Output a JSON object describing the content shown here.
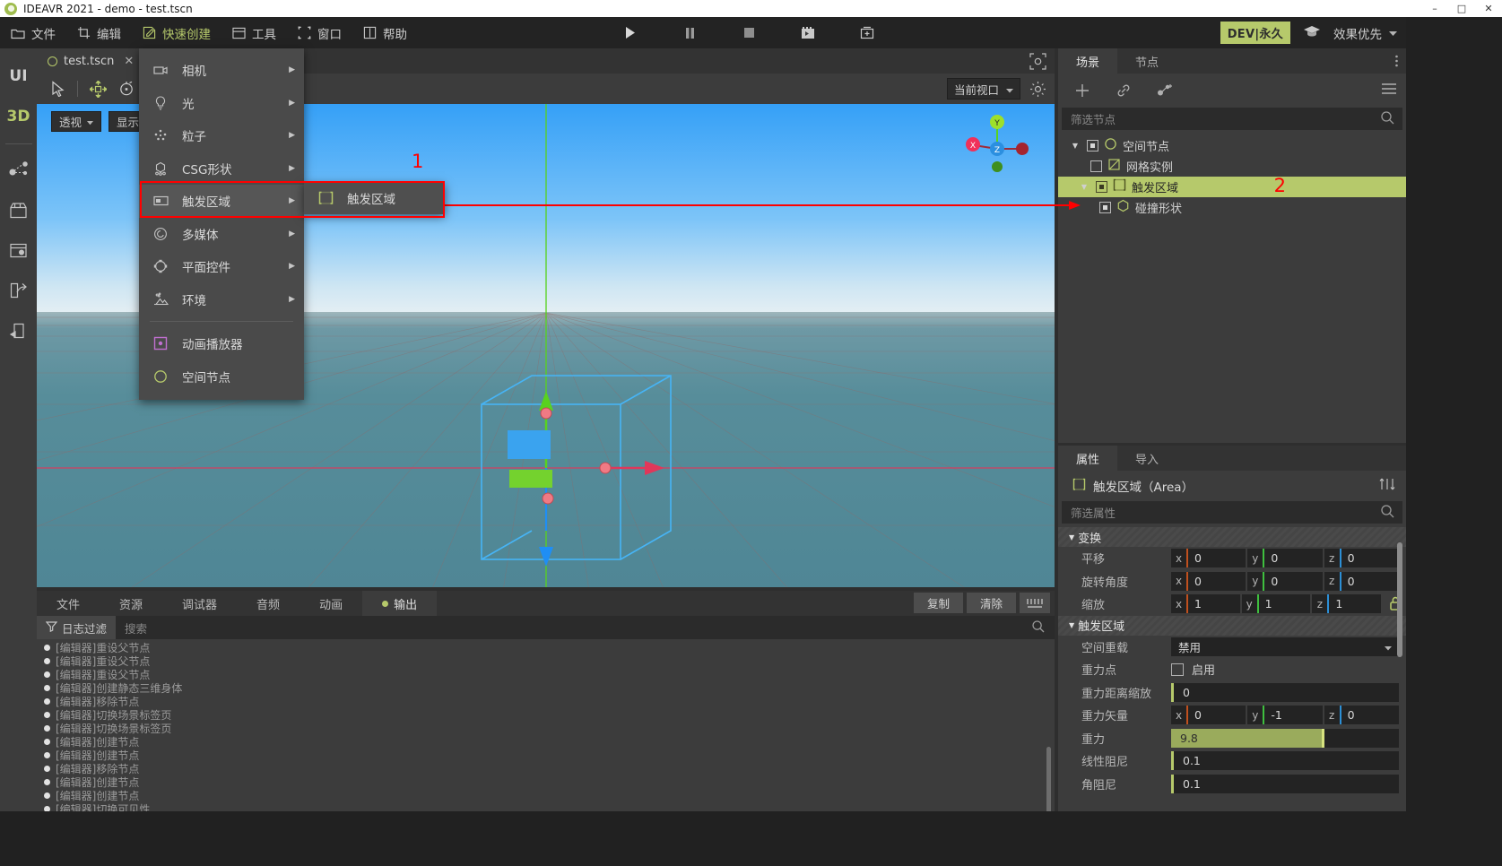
{
  "titlebar": {
    "title": "IDEAVR 2021 - demo - test.tscn",
    "minimize": "–",
    "maximize": "□",
    "close": "✕"
  },
  "menubar": {
    "items": [
      {
        "label": "文件",
        "icon": "folder-icon",
        "active": false
      },
      {
        "label": "编辑",
        "icon": "crop-icon",
        "active": false
      },
      {
        "label": "快速创建",
        "icon": "pencil-square-icon",
        "active": true
      },
      {
        "label": "工具",
        "icon": "window-icon",
        "active": false
      },
      {
        "label": "窗口",
        "icon": "frame-icon",
        "active": false
      },
      {
        "label": "帮助",
        "icon": "book-icon",
        "active": false
      }
    ],
    "play_controls": [
      "play-icon",
      "pause-icon",
      "stop-icon",
      "movie-icon",
      "movie-add-icon"
    ],
    "dev_badge": "DEV|永久",
    "graduation_icon": "graduation-cap-icon",
    "quality_label": "效果优先",
    "accent": "#b6c96b"
  },
  "left_rail": {
    "items": [
      {
        "label": "UI",
        "name": "rail-item-ui",
        "selected": false
      },
      {
        "label": "3D",
        "name": "rail-item-3d",
        "selected": true
      },
      {
        "label": "",
        "name": "rail-item-graph",
        "icon": "node-graph-icon",
        "selected": false
      },
      {
        "label": "",
        "name": "rail-item-store",
        "icon": "store-icon",
        "selected": false
      },
      {
        "label": "",
        "name": "rail-item-settings",
        "icon": "window-settings-icon",
        "selected": false
      },
      {
        "label": "",
        "name": "rail-item-export",
        "icon": "share-export-icon",
        "selected": false
      },
      {
        "label": "",
        "name": "rail-item-publish",
        "icon": "publish-icon",
        "selected": false
      }
    ]
  },
  "viewport": {
    "tab": {
      "label": "test.tscn",
      "close": "✕"
    },
    "focus_icon": "focus-frame-icon",
    "tools": [
      "select-arrow-icon",
      "move-icon",
      "rotate-icon",
      "scale-icon"
    ],
    "overlays": [
      {
        "label": "透视",
        "name": "perspective-dropdown"
      },
      {
        "label": "显示",
        "name": "display-dropdown"
      }
    ],
    "view_select": "当前视口",
    "gear_icon": "gear-icon",
    "gizmo_axes": [
      "X",
      "Y",
      "Z"
    ]
  },
  "quick_create_menu": {
    "items": [
      {
        "label": "相机",
        "icon": "camera-icon",
        "submenu": true,
        "highlight": false
      },
      {
        "label": "光",
        "icon": "bulb-icon",
        "submenu": true,
        "highlight": false
      },
      {
        "label": "粒子",
        "icon": "particles-icon",
        "submenu": true,
        "highlight": false
      },
      {
        "label": "CSG形状",
        "icon": "csg-icon",
        "submenu": true,
        "highlight": false
      },
      {
        "label": "触发区域",
        "icon": "trigger-area-icon",
        "submenu": true,
        "highlight": true
      },
      {
        "label": "多媒体",
        "icon": "media-icon",
        "submenu": true,
        "highlight": false
      },
      {
        "label": "平面控件",
        "icon": "plane-control-icon",
        "submenu": true,
        "highlight": false
      },
      {
        "label": "环境",
        "icon": "environment-icon",
        "submenu": true,
        "highlight": false
      }
    ],
    "extra_items": [
      {
        "label": "动画播放器",
        "icon": "anim-player-icon",
        "submenu": false
      },
      {
        "label": "空间节点",
        "icon": "spatial-node-icon",
        "submenu": false
      }
    ],
    "submenu": {
      "items": [
        {
          "label": "触发区域",
          "icon": "trigger-area-icon"
        }
      ]
    },
    "annotation_1": "1",
    "annotation_2": "2",
    "annotation_color": "#ff0000"
  },
  "bottom_panel": {
    "tabs": [
      {
        "label": "文件",
        "active": false,
        "dot": false
      },
      {
        "label": "资源",
        "active": false,
        "dot": false
      },
      {
        "label": "调试器",
        "active": false,
        "dot": false
      },
      {
        "label": "音频",
        "active": false,
        "dot": false
      },
      {
        "label": "动画",
        "active": false,
        "dot": false
      },
      {
        "label": "输出",
        "active": true,
        "dot": true
      }
    ],
    "actions": [
      {
        "label": "复制",
        "name": "copy-button"
      },
      {
        "label": "清除",
        "name": "clear-button"
      }
    ],
    "collapse_icon": "collapse-down-icon",
    "log_filter_label": "日志过滤",
    "search_placeholder": "搜索",
    "log_lines": [
      "[编辑器]重设父节点",
      "[编辑器]重设父节点",
      "[编辑器]重设父节点",
      "[编辑器]创建静态三维身体",
      "[编辑器]移除节点",
      "[编辑器]切换场景标签页",
      "[编辑器]切换场景标签页",
      "[编辑器]创建节点",
      "[编辑器]创建节点",
      "[编辑器]移除节点",
      "[编辑器]创建节点",
      "[编辑器]创建节点",
      "[编辑器]切换可见性"
    ]
  },
  "scene_panel": {
    "tabs": [
      {
        "label": "场景",
        "active": true
      },
      {
        "label": "节点",
        "active": false
      }
    ],
    "toolbar": [
      "add-node-icon",
      "link-icon",
      "instance-child-icon"
    ],
    "menu_icon": "hamburger-icon",
    "filter_placeholder": "筛选节点",
    "tree": [
      {
        "label": "空间节点",
        "depth": 0,
        "twisty": "▼",
        "icon": "spatial-node-icon",
        "selected": false,
        "vis": true
      },
      {
        "label": "网格实例",
        "depth": 1,
        "twisty": "",
        "icon": "mesh-instance-icon",
        "selected": false,
        "vis": false
      },
      {
        "label": "触发区域",
        "depth": 1,
        "twisty": "▼",
        "icon": "trigger-area-icon",
        "selected": true,
        "vis": true
      },
      {
        "label": "碰撞形状",
        "depth": 2,
        "twisty": "",
        "icon": "collision-shape-icon",
        "selected": false,
        "vis": true
      }
    ]
  },
  "properties_panel": {
    "tabs": [
      {
        "label": "属性",
        "active": true
      },
      {
        "label": "导入",
        "active": false
      }
    ],
    "header": "触发区域（Area）",
    "header_icon": "trigger-area-icon",
    "tools_icon": "sort-tools-icon",
    "filter_placeholder": "筛选属性",
    "sections": [
      {
        "title": "变换",
        "rows": [
          {
            "label": "平移",
            "type": "vec3",
            "axes": [
              "x",
              "y",
              "z"
            ],
            "values": [
              "0",
              "0",
              "0"
            ]
          },
          {
            "label": "旋转角度",
            "type": "vec3",
            "axes": [
              "x",
              "y",
              "z"
            ],
            "values": [
              "0",
              "0",
              "0"
            ]
          },
          {
            "label": "缩放",
            "type": "vec3-lock",
            "axes": [
              "x",
              "y",
              "z"
            ],
            "values": [
              "1",
              "1",
              "1"
            ],
            "lock_icon": "unlock-icon"
          }
        ]
      },
      {
        "title": "触发区域",
        "rows": [
          {
            "label": "空间重载",
            "type": "select",
            "value": "禁用"
          },
          {
            "label": "重力点",
            "type": "checkbox",
            "value": "启用",
            "checked": false
          },
          {
            "label": "重力距离缩放",
            "type": "number",
            "value": "0"
          },
          {
            "label": "重力矢量",
            "type": "vec3",
            "axes": [
              "x",
              "y",
              "z"
            ],
            "values": [
              "0",
              "-1",
              "0"
            ]
          },
          {
            "label": "重力",
            "type": "slider",
            "value": "9.8",
            "fill_pct": 67
          },
          {
            "label": "线性阻尼",
            "type": "number",
            "value": "0.1"
          },
          {
            "label": "角阻尼",
            "type": "number",
            "value": "0.1"
          }
        ]
      }
    ]
  }
}
